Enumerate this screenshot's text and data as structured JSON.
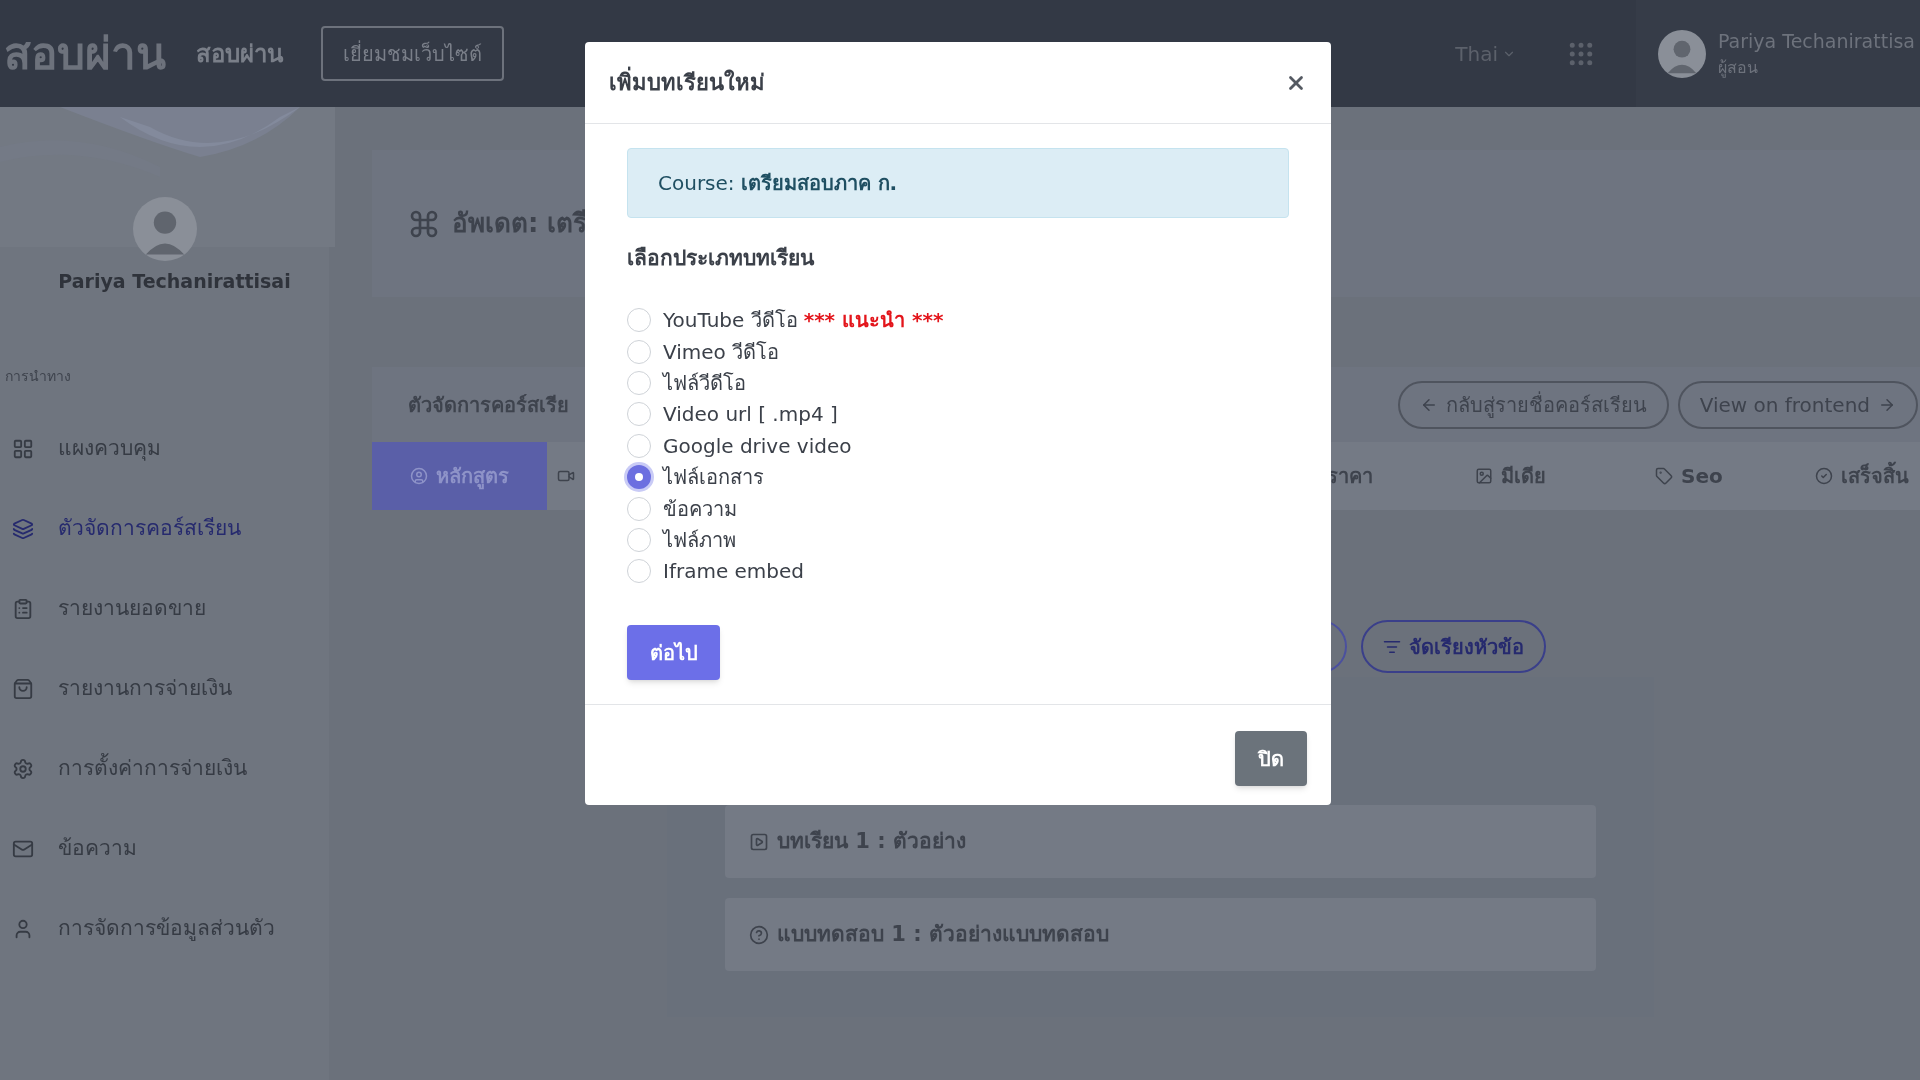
{
  "header": {
    "logo": "สอบผ่าน",
    "site_name": "สอบผ่าน",
    "visit_button": "เยี่ยมชมเว็บไซต์",
    "language": "Thai",
    "user": {
      "name": "Pariya Techanirattisa",
      "role": "ผู้สอน"
    }
  },
  "sidebar": {
    "profile_name": "Pariya Techanirattisai",
    "nav_heading": "การนำทาง",
    "items": [
      {
        "label": "แผงควบคุม",
        "selected": false
      },
      {
        "label": "ตัวจัดการคอร์สเรียน",
        "selected": true
      },
      {
        "label": "รายงานยอดขาย",
        "selected": false
      },
      {
        "label": "รายงานการจ่ายเงิน",
        "selected": false
      },
      {
        "label": "การตั้งค่าการจ่ายเงิน",
        "selected": false
      },
      {
        "label": "ข้อความ",
        "selected": false
      },
      {
        "label": "การจัดการข้อมูลส่วนตัว",
        "selected": false
      }
    ]
  },
  "main": {
    "page_title": "อัพเดต: เตรี",
    "manager_title": "ตัวจัดการคอร์สเรีย",
    "back_button": "กลับสู่รายชื่อคอร์สเรียน",
    "frontend_button": "View on frontend",
    "tabs": [
      {
        "label": "หลักสูตร",
        "selected": true
      },
      {
        "label": "ราคา",
        "selected": false
      },
      {
        "label": "มีเดีย",
        "selected": false
      },
      {
        "label": "Seo",
        "selected": false
      },
      {
        "label": "เสร็จสิ้น",
        "selected": false
      }
    ],
    "sort_button": "จัดเรียงหัวข้อ",
    "lessons": [
      {
        "kind": "lesson",
        "title": "บทเรียน 1 : ตัวอย่าง"
      },
      {
        "kind": "quiz",
        "title": "แบบทดสอบ 1 : ตัวอย่างแบบทดสอบ"
      }
    ]
  },
  "modal": {
    "title": "เพิ่มบทเรียนใหม่",
    "alert": {
      "label": "Course:",
      "value": "เตรียมสอบภาค ก."
    },
    "heading": "เลือกประเภทบทเรียน",
    "options": [
      {
        "label": "YouTube วีดีโอ",
        "note": "*** แนะนำ ***",
        "selected": false
      },
      {
        "label": "Vimeo วีดีโอ",
        "selected": false
      },
      {
        "label": "ไฟล์วีดีโอ",
        "selected": false
      },
      {
        "label": "Video url [ .mp4 ]",
        "selected": false
      },
      {
        "label": "Google drive video",
        "selected": false
      },
      {
        "label": "ไฟล์เอกสาร",
        "selected": true
      },
      {
        "label": "ข้อความ",
        "selected": false
      },
      {
        "label": "ไฟล์ภาพ",
        "selected": false
      },
      {
        "label": "Iframe embed",
        "selected": false
      }
    ],
    "next_button": "ต่อไป",
    "close_button": "ปิด"
  }
}
